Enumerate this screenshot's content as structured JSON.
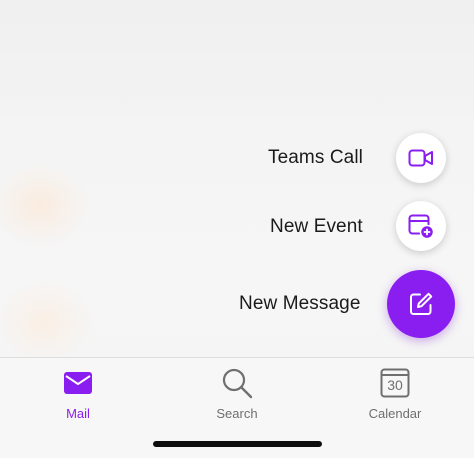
{
  "colors": {
    "accent": "#8a1df0",
    "tab_inactive": "#6f6f6f",
    "label_text": "#1b1b1b"
  },
  "fab_menu": {
    "teams_call": {
      "label": "Teams Call",
      "icon": "video-camera-icon"
    },
    "new_event": {
      "label": "New Event",
      "icon": "calendar-add-icon"
    },
    "new_message": {
      "label": "New Message",
      "icon": "compose-icon"
    }
  },
  "tabbar": {
    "tabs": [
      {
        "label": "Mail",
        "icon": "mail-icon",
        "active": true
      },
      {
        "label": "Search",
        "icon": "search-icon",
        "active": false
      },
      {
        "label": "Calendar",
        "icon": "calendar-icon",
        "active": false,
        "badge": "30"
      }
    ]
  }
}
